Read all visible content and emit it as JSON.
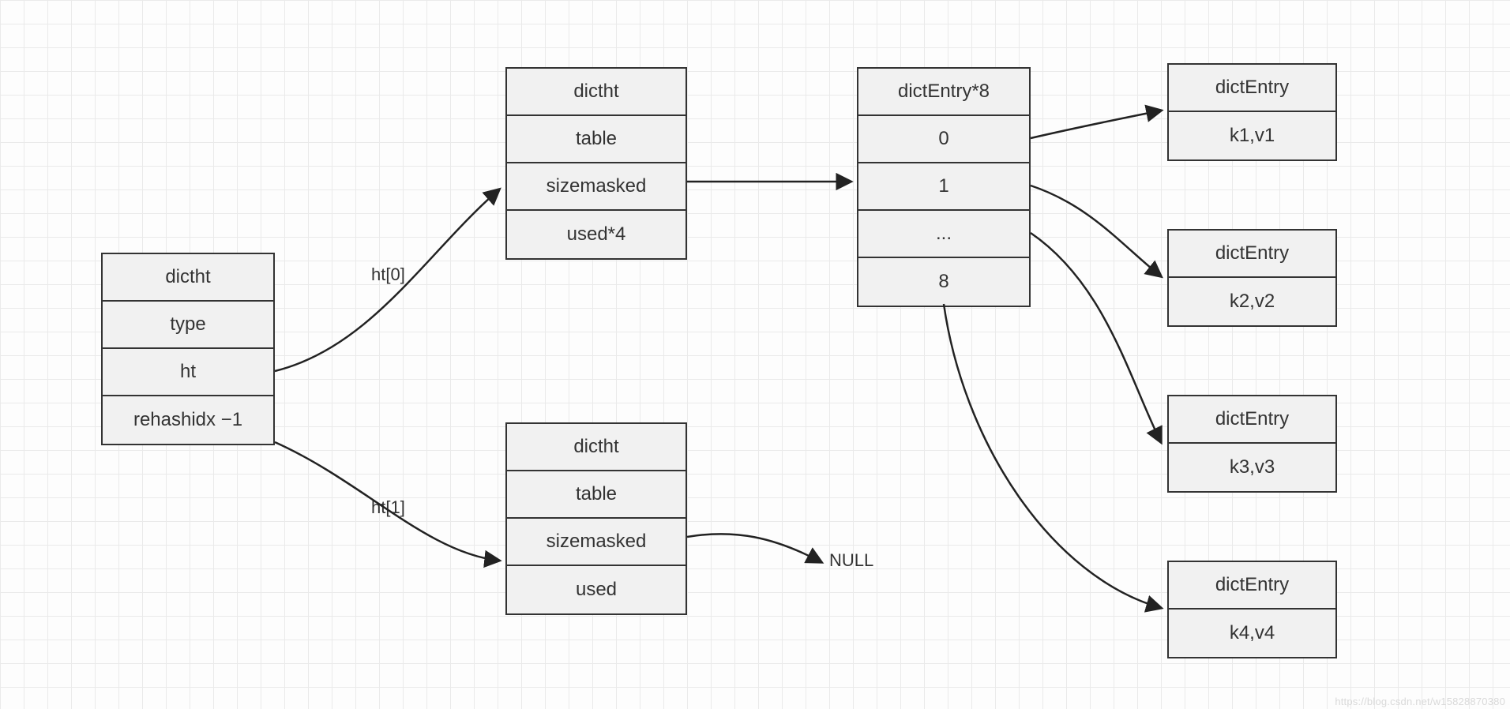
{
  "dict": {
    "cells": [
      "dictht",
      "type",
      "ht",
      "rehashidx −1"
    ]
  },
  "ht0": {
    "cells": [
      "dictht",
      "table",
      "sizemasked",
      "used*4"
    ]
  },
  "ht1": {
    "cells": [
      "dictht",
      "table",
      "sizemasked",
      "used"
    ]
  },
  "entries": {
    "cells": [
      "dictEntry*8",
      "0",
      "1",
      "...",
      "8"
    ]
  },
  "entry0": {
    "cells": [
      "dictEntry",
      "k1,v1"
    ]
  },
  "entry1": {
    "cells": [
      "dictEntry",
      "k2,v2"
    ]
  },
  "entry2": {
    "cells": [
      "dictEntry",
      "k3,v3"
    ]
  },
  "entry3": {
    "cells": [
      "dictEntry",
      "k4,v4"
    ]
  },
  "labels": {
    "ht0": "ht[0]",
    "ht1": "ht[1]",
    "null": "NULL"
  },
  "watermark": "https://blog.csdn.net/w15828870380"
}
